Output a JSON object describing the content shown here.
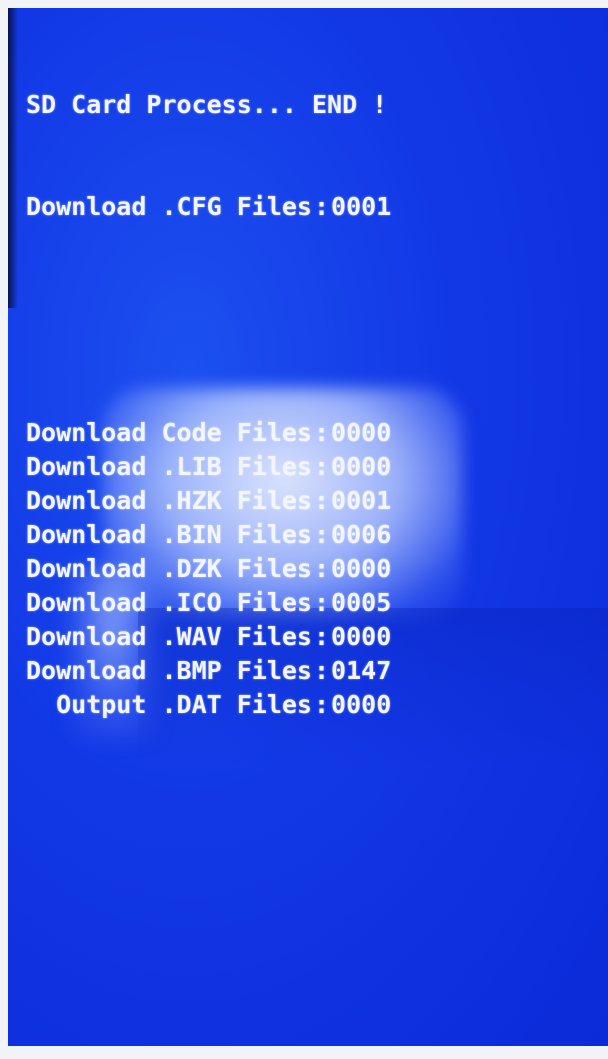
{
  "header": {
    "status_line": "SD Card Process... END !"
  },
  "config_line": {
    "label": "Download .CFG Files",
    "count": "0001"
  },
  "files": [
    {
      "label": "Download Code Files",
      "count": "0000"
    },
    {
      "label": "Download .LIB Files",
      "count": "0000"
    },
    {
      "label": "Download .HZK Files",
      "count": "0001"
    },
    {
      "label": "Download .BIN Files",
      "count": "0006"
    },
    {
      "label": "Download .DZK Files",
      "count": "0000"
    },
    {
      "label": "Download .ICO Files",
      "count": "0005"
    },
    {
      "label": "Download .WAV Files",
      "count": "0000"
    },
    {
      "label": "Download .BMP Files",
      "count": "0147"
    },
    {
      "label": "  Output .DAT Files",
      "count": "0000"
    }
  ],
  "separator": ":",
  "colors": {
    "screen_blue": "#1238e6",
    "text": "#f4f6ff"
  }
}
